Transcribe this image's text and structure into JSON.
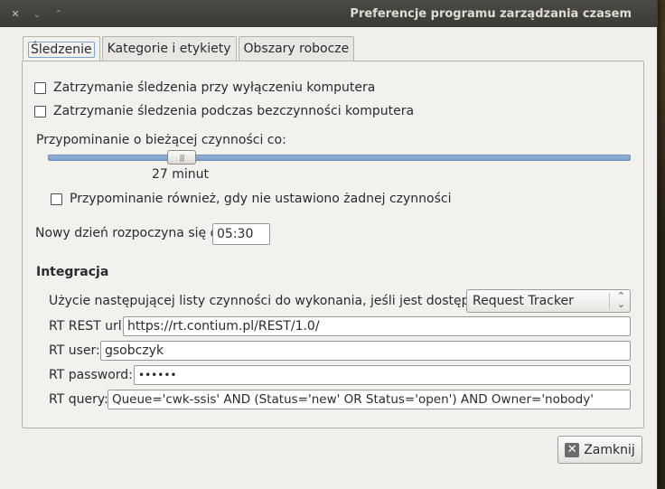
{
  "window": {
    "title": "Preferencje programu zarządzania czasem",
    "controls": {
      "close": "✕",
      "minimize": "⌄",
      "maximize": "⌃"
    }
  },
  "tabs": [
    {
      "label": "Śledzenie",
      "active": true
    },
    {
      "label": "Kategorie i etykiety",
      "active": false
    },
    {
      "label": "Obszary robocze",
      "active": false
    }
  ],
  "tracking": {
    "stop_on_shutdown": {
      "label": "Zatrzymanie śledzenia przy wyłączeniu komputera",
      "checked": false
    },
    "stop_on_idle": {
      "label": "Zatrzymanie śledzenia podczas bezczynności komputera",
      "checked": false
    },
    "reminder_label": "Przypominanie o bieżącej czynności co:",
    "reminder_value_text": "27 minut",
    "reminder_fraction": 0.2,
    "remind_no_activity": {
      "label": "Przypominanie również, gdy nie ustawiono żadnej czynności",
      "checked": false
    },
    "new_day_label": "Nowy dzień rozpoczyna się o",
    "new_day_value": "05:30"
  },
  "integration": {
    "heading": "Integracja",
    "todo_label": "Użycie następującej listy czynności do wykonania, jeśli jest dostępna:",
    "todo_selected": "Request Tracker",
    "rt_url_label": "RT REST url:",
    "rt_url_value": "https://rt.contium.pl/REST/1.0/",
    "rt_user_label": "RT user:",
    "rt_user_value": "gsobczyk",
    "rt_password_label": "RT password:",
    "rt_password_value": "••••••",
    "rt_query_label": "RT query:",
    "rt_query_value": "Queue='cwk-ssis' AND (Status='new' OR Status='open') AND Owner='nobody'"
  },
  "footer": {
    "close_label": "Zamknij"
  }
}
